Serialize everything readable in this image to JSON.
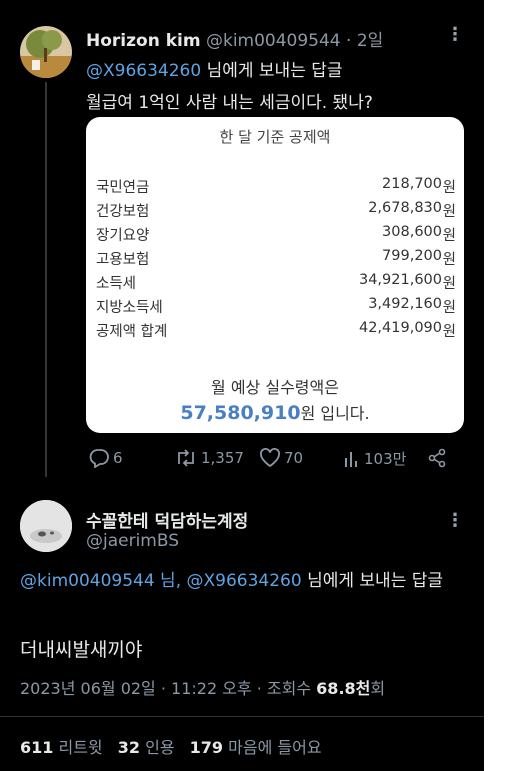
{
  "tweet1": {
    "display_name": "Horizon kim",
    "handle": "@kim00409544",
    "separator": "·",
    "time": "2일",
    "reply_handle": "@X96634260",
    "reply_suffix": " 님에게 보내는 답글",
    "text": "월급여 1억인 사람 내는 세금이다. 됐나?",
    "card": {
      "title": "한 달 기준 공제액",
      "unit": "원",
      "rows": [
        {
          "label": "국민연금",
          "amount": "218,700"
        },
        {
          "label": "건강보험",
          "amount": "2,678,830"
        },
        {
          "label": "장기요양",
          "amount": "308,600"
        },
        {
          "label": "고용보험",
          "amount": "799,200"
        },
        {
          "label": "소득세",
          "amount": "34,921,600"
        },
        {
          "label": "지방소득세",
          "amount": "3,492,160"
        },
        {
          "label": "공제액 합계",
          "amount": "42,419,090"
        }
      ],
      "summary_line1": "월 예상 실수령액은",
      "summary_amount": "57,580,910",
      "summary_suffix": "원 입니다."
    },
    "actions": {
      "replies": "6",
      "retweets": "1,357",
      "likes": "70",
      "views": "103만"
    }
  },
  "tweet2": {
    "display_name": "수꼴한테 덕담하는계정",
    "handle": "@jaerimBS",
    "reply_handles": "@kim00409544 님, @X96634260",
    "reply_suffix": " 님에게 보내는 답글",
    "text": "더내씨발새끼야",
    "date": "2023년 06월 02일 · 11:22 오후 · 조회수 ",
    "views": "68.8천",
    "views_suffix": "회",
    "stats": {
      "retweets": "611",
      "retweets_label": " 리트윗",
      "quotes": "32",
      "quotes_label": " 인용",
      "likes": "179",
      "likes_label": " 마음에 들어요"
    }
  },
  "colors": {
    "background": "#000000",
    "link": "#5ea3e2",
    "muted": "#8b98a5",
    "summary_amount": "#4a7fc1"
  }
}
